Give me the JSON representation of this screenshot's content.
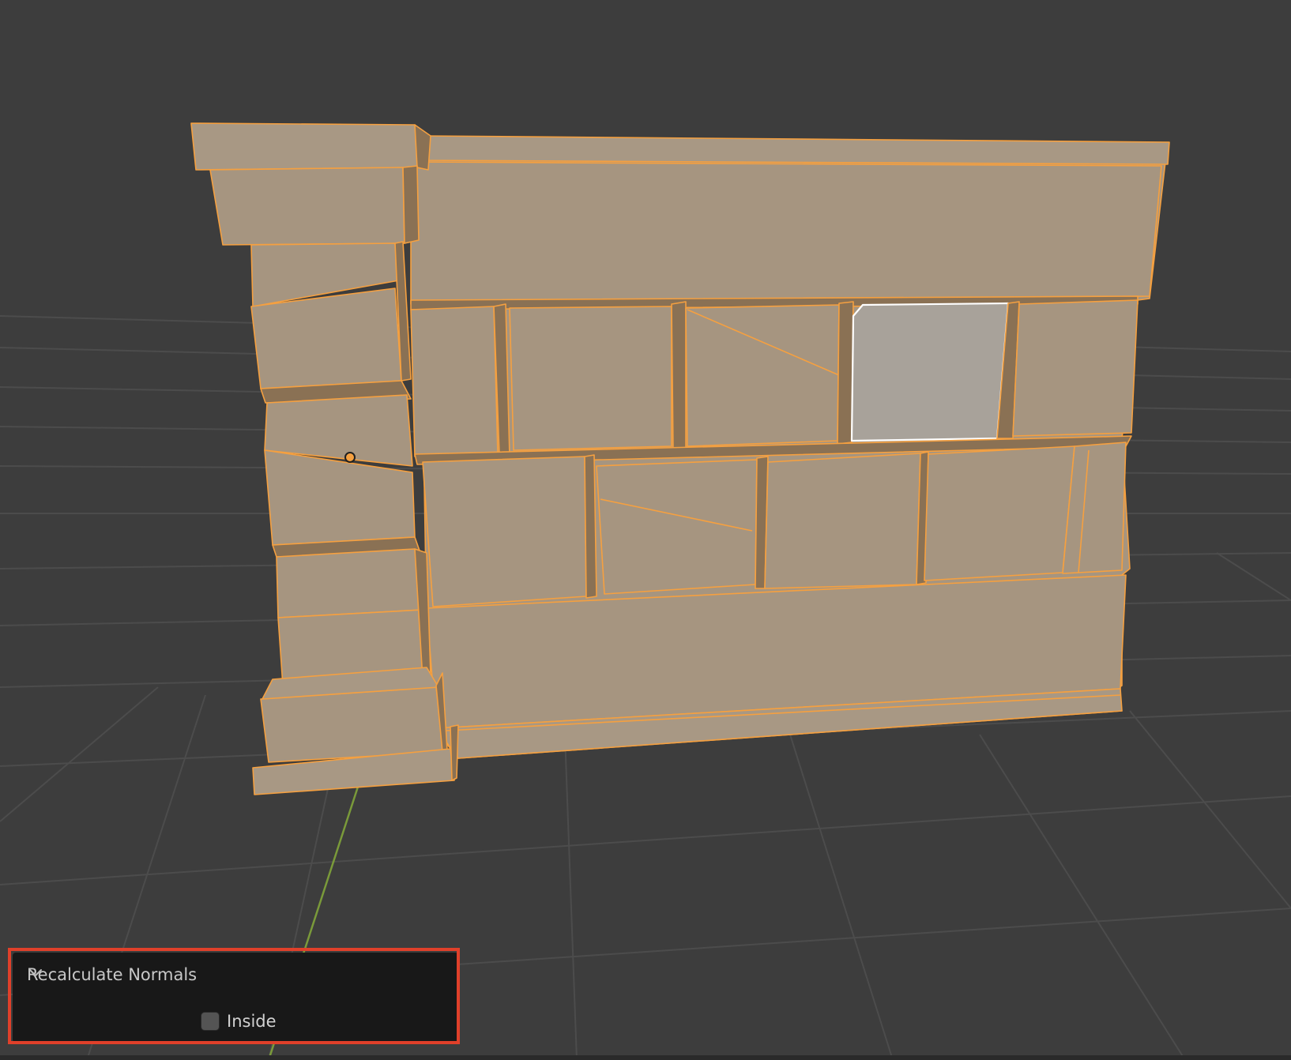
{
  "app": {
    "name": "Blender 3D Viewport"
  },
  "viewport": {
    "mode": "edit-mode",
    "background_color": "#3d3d3d",
    "grid_color": "#4c4c4c",
    "y_axis_color": "#7a9a3a",
    "mesh_face_color": "#a69580",
    "mesh_dark_color": "#8a7154",
    "selected_edge_color": "#f5a040",
    "active_face_color": "#a8a29a",
    "active_face_outline": "#ffffff"
  },
  "operator_panel": {
    "title": "Recalculate Normals",
    "expanded": true,
    "inside_label": "Inside",
    "inside_checked": false,
    "highlight_color": "#e0402a",
    "icons": {
      "collapse": "chevron-down-icon"
    }
  }
}
